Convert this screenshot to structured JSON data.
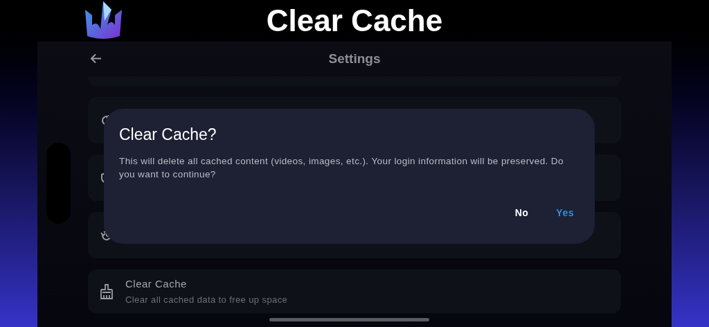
{
  "banner": {
    "title": "Clear Cache"
  },
  "app_bar": {
    "title": "Settings"
  },
  "settings_items": [
    {
      "kind": "cut"
    },
    {
      "kind": "row"
    },
    {
      "kind": "row"
    },
    {
      "kind": "row"
    },
    {
      "kind": "row",
      "title": "Clear Cache",
      "subtitle": "Clear all cached data to free up space"
    }
  ],
  "dialog": {
    "title": "Clear Cache?",
    "message": "This will delete all cached content (videos, images, etc.). Your login information will be preserved. Do you want to continue?",
    "buttons": [
      {
        "label": "No",
        "kind": "neutral"
      },
      {
        "label": "Yes",
        "kind": "primary"
      }
    ]
  }
}
